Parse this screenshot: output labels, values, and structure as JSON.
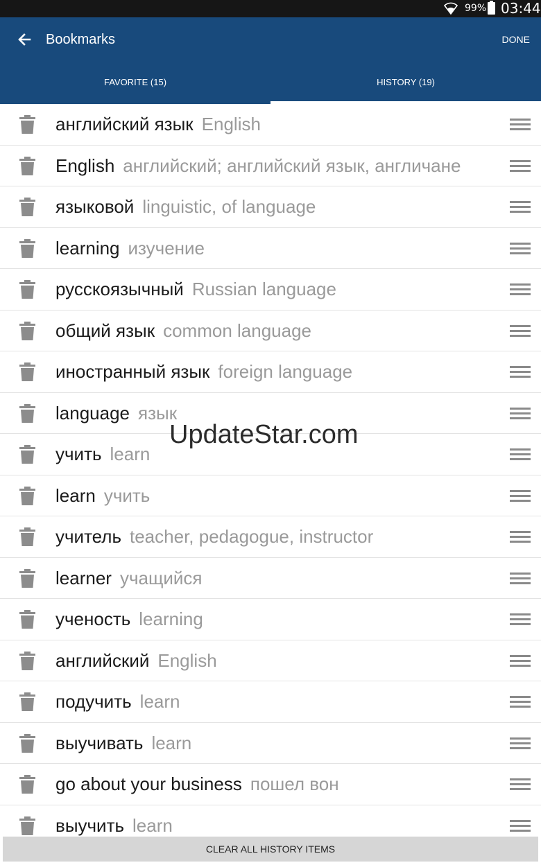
{
  "status_bar": {
    "battery": "99%",
    "time": "03:44"
  },
  "app_bar": {
    "title": "Bookmarks",
    "done_label": "DONE",
    "back_icon": "arrow-left-icon",
    "color": "#184a7c"
  },
  "tabs": [
    {
      "label": "FAVORITE (15)",
      "selected": false
    },
    {
      "label": "HISTORY (19)",
      "selected": true
    }
  ],
  "items": [
    {
      "term": "английский язык",
      "translation": "English"
    },
    {
      "term": "English",
      "translation": "английский; английский язык, англичане"
    },
    {
      "term": "языковой",
      "translation": "linguistic, of language"
    },
    {
      "term": "learning",
      "translation": "изучение"
    },
    {
      "term": "русскоязычный",
      "translation": "Russian language"
    },
    {
      "term": "общий язык",
      "translation": "common language"
    },
    {
      "term": "иностранный язык",
      "translation": "foreign language"
    },
    {
      "term": "language",
      "translation": "язык"
    },
    {
      "term": "учить",
      "translation": "learn"
    },
    {
      "term": "learn",
      "translation": "учить"
    },
    {
      "term": "учитель",
      "translation": "teacher, pedagogue, instructor"
    },
    {
      "term": "learner",
      "translation": "учащийся"
    },
    {
      "term": "ученость",
      "translation": "learning"
    },
    {
      "term": "английский",
      "translation": "English"
    },
    {
      "term": "подучить",
      "translation": "learn"
    },
    {
      "term": "выучивать",
      "translation": "learn"
    },
    {
      "term": "go about your business",
      "translation": "пошел вон"
    },
    {
      "term": "выучить",
      "translation": "learn"
    }
  ],
  "watermark": "UpdateStar.com",
  "footer": {
    "clear_label": "CLEAR ALL HISTORY ITEMS"
  }
}
